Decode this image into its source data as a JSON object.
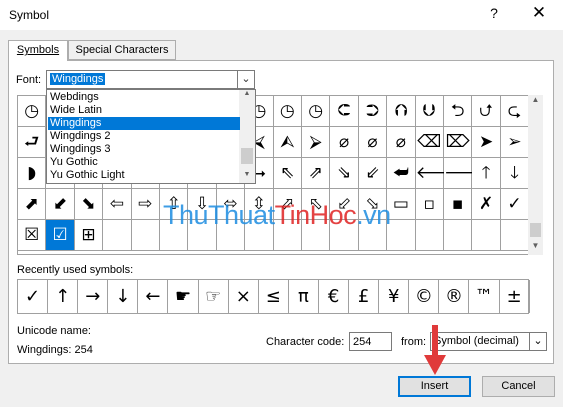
{
  "window": {
    "title": "Symbol",
    "help_glyph": "?",
    "close_glyph": "✕"
  },
  "tabs": [
    {
      "label": "Symbols",
      "active": true
    },
    {
      "label": "Special Characters",
      "active": false
    }
  ],
  "font": {
    "label": "Font:",
    "value": "Wingdings",
    "arrow": "⌄"
  },
  "font_dropdown": {
    "items": [
      "Webdings",
      "Wide Latin",
      "Wingdings",
      "Wingdings 2",
      "Wingdings 3",
      "Yu Gothic",
      "Yu Gothic Light"
    ],
    "highlighted": "Wingdings"
  },
  "symbol_grid": {
    "rows": [
      [
        "◷",
        "◷",
        "◶",
        "◶",
        "◶",
        "◶",
        "◶",
        "◶",
        "◷",
        "◷",
        "◷",
        "⮈",
        "⮊",
        "⮉",
        "⮋",
        "⮌",
        "⮍",
        "⮎"
      ],
      [
        "⮐",
        "⮑",
        "⮒",
        "⮓",
        "⮔",
        "⮕",
        "⮖",
        "⮗",
        "⮘",
        "⮙",
        "⮚",
        "⌀",
        "⌀",
        "⌀",
        "⌫",
        "⌦",
        "➤",
        "➢"
      ],
      [
        "◗",
        "⮜",
        "⮝",
        "⮞",
        "⮟",
        "⮠",
        "⮡",
        "⮢",
        "⮣",
        "⇖",
        "⇗",
        "⇘",
        "⇙",
        "⮨",
        "🡐",
        "🡒",
        "🡑",
        "🡓"
      ],
      [
        "⬈",
        "⬋",
        "⬊",
        "⇦",
        "⇨",
        "⇧",
        "⇩",
        "⬄",
        "⇳",
        "⬀",
        "⬁",
        "⬃",
        "⬂",
        "▭",
        "▫",
        "▪",
        "✗",
        "✓"
      ],
      [
        "☒",
        "☑",
        "⊞",
        "",
        "",
        "",
        "",
        "",
        "",
        "",
        "",
        "",
        "",
        "",
        "",
        "",
        "",
        ""
      ]
    ],
    "selected": {
      "row": 4,
      "col": 1
    }
  },
  "recent": {
    "label": "Recently used symbols:",
    "symbols": [
      "✓",
      "↑",
      "→",
      "↓",
      "←",
      "☛",
      "☞",
      "×",
      "≤",
      "π",
      "€",
      "£",
      "¥",
      "©",
      "®",
      "™",
      "±"
    ]
  },
  "unicode": {
    "label": "Unicode name:",
    "value": "Wingdings: 254"
  },
  "character_code": {
    "label": "Character code:",
    "value": "254"
  },
  "from": {
    "label": "from:",
    "value": "Symbol (decimal)",
    "arrow": "⌄"
  },
  "buttons": {
    "insert": "Insert",
    "cancel": "Cancel"
  },
  "watermark": {
    "part1": "Thu",
    "part2": "Thuat",
    "part3": "Tin",
    "part4": "Hoc",
    "part5": ".vn"
  },
  "colors": {
    "accent": "#0078d7",
    "watermark_blue": "#1d8de1",
    "watermark_red": "#e02323",
    "arrow_red": "#e03a3a"
  }
}
